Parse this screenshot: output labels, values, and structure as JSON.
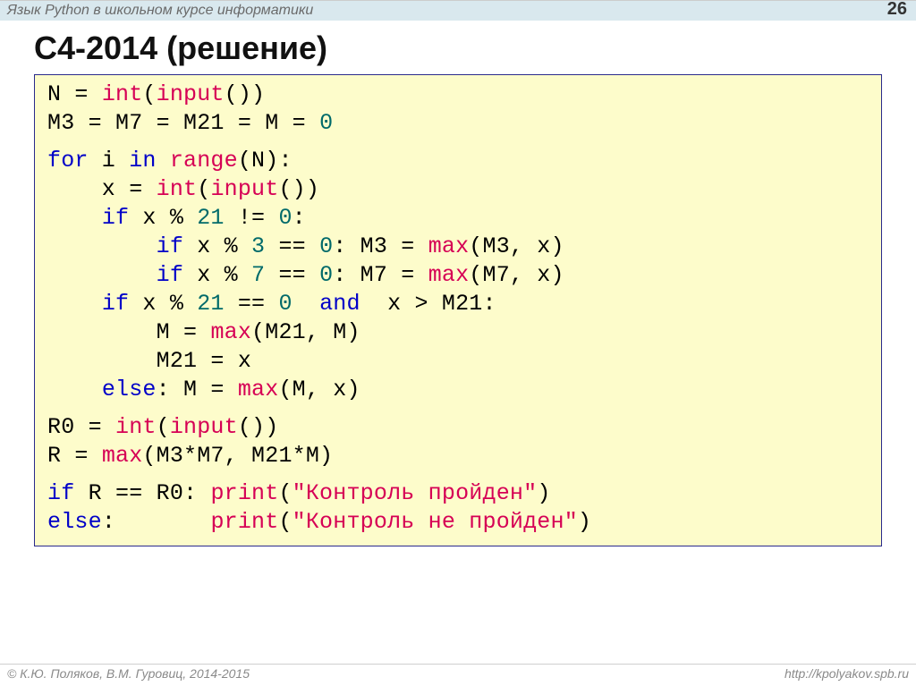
{
  "header": {
    "subject": "Язык Python в школьном курсе информатики",
    "page_number": "26"
  },
  "title": "С4-2014 (решение)",
  "code": {
    "l1a": "N = ",
    "l1b": "int",
    "l1c": "(",
    "l1d": "input",
    "l1e": "())",
    "l2a": "M3 = M7 = M21 = M = ",
    "l2b": "0",
    "l3a": "for",
    "l3b": " i ",
    "l3c": "in",
    "l3d": " ",
    "l3e": "range",
    "l3f": "(N):",
    "l4a": "    x = ",
    "l4b": "int",
    "l4c": "(",
    "l4d": "input",
    "l4e": "())",
    "l5a": "    ",
    "l5b": "if",
    "l5c": " x % ",
    "l5d": "21",
    "l5e": " != ",
    "l5f": "0",
    "l5g": ":",
    "l6a": "        ",
    "l6b": "if",
    "l6c": " x % ",
    "l6d": "3",
    "l6e": " == ",
    "l6f": "0",
    "l6g": ": M3 = ",
    "l6h": "max",
    "l6i": "(M3, x)",
    "l7a": "        ",
    "l7b": "if",
    "l7c": " x % ",
    "l7d": "7",
    "l7e": " == ",
    "l7f": "0",
    "l7g": ": M7 = ",
    "l7h": "max",
    "l7i": "(M7, x)",
    "l8a": "    ",
    "l8b": "if",
    "l8c": " x % ",
    "l8d": "21",
    "l8e": " == ",
    "l8f": "0",
    "l8g": "  ",
    "l8h": "and",
    "l8i": "  x > M21:",
    "l9a": "        M = ",
    "l9b": "max",
    "l9c": "(M21, M)",
    "l10a": "        M21 = x",
    "l11a": "    ",
    "l11b": "else",
    "l11c": ": M = ",
    "l11d": "max",
    "l11e": "(M, x)",
    "l12a": "R0 = ",
    "l12b": "int",
    "l12c": "(",
    "l12d": "input",
    "l12e": "())",
    "l13a": "R = ",
    "l13b": "max",
    "l13c": "(M3*M7, M21*M)",
    "l14a": "if",
    "l14b": " R == R0: ",
    "l14c": "print",
    "l14d": "(",
    "l14e": "\"Контроль пройден\"",
    "l14f": ")",
    "l15a": "else",
    "l15b": ":       ",
    "l15c": "print",
    "l15d": "(",
    "l15e": "\"Контроль не пройден\"",
    "l15f": ")"
  },
  "footer": {
    "left": "© К.Ю. Поляков, В.М. Гуровиц, 2014-2015",
    "right": "http://kpolyakov.spb.ru"
  }
}
